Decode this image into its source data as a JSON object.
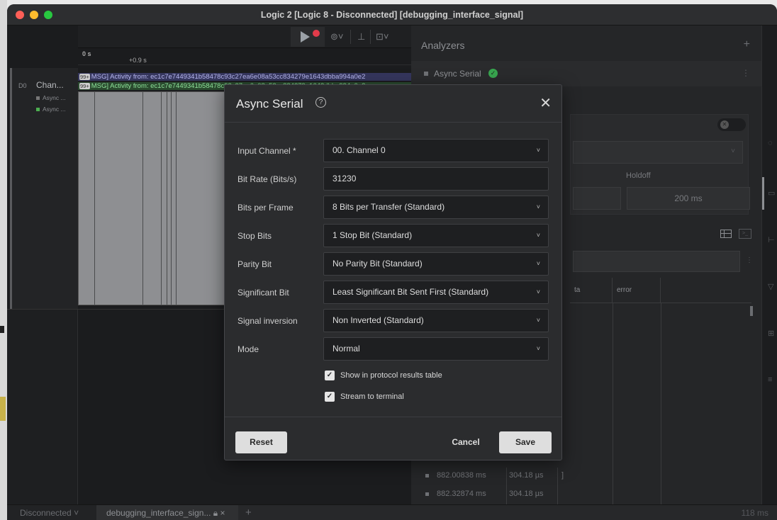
{
  "window": {
    "title": "Logic 2 [Logic 8 - Disconnected] [debugging_interface_signal]"
  },
  "ruler": {
    "t0": "0 s",
    "t1": "+0.9 s"
  },
  "channel": {
    "id": "D0",
    "name": "Chan...",
    "subs": [
      {
        "label": "Async ...",
        "color": "#777777"
      },
      {
        "label": "Async ...",
        "color": "#4caf50"
      }
    ]
  },
  "messages": {
    "badge": "99+",
    "msg1": "MSG] Activity from: ec1c7e7449341b58478c93c27ea6e08a53cc834279e1643dbba994a0e2",
    "msg2": "MSG] Activity from: ec1c7e7449341b58478c93c27ea6e08a53cc834279e1643dbba994a0e2"
  },
  "analyzers": {
    "title": "Analyzers",
    "add": "+",
    "items": [
      {
        "name": "Async Serial",
        "status": "ok"
      }
    ],
    "holdoff_label": "Holdoff",
    "holdoff_value": "200 ms",
    "columns": [
      "ta",
      "error"
    ],
    "results": [
      {
        "time": "882.00838 ms",
        "duration": "304.18 µs",
        "mark": "]"
      },
      {
        "time": "882.32874 ms",
        "duration": "304.18 µs",
        "mark": ""
      }
    ]
  },
  "dialog": {
    "title": "Async Serial",
    "help": "?",
    "close": "✕",
    "fields": [
      {
        "label": "Input Channel *",
        "value": "00.  Channel 0",
        "type": "select"
      },
      {
        "label": "Bit Rate (Bits/s)",
        "value": "31230",
        "type": "input"
      },
      {
        "label": "Bits per Frame",
        "value": "8 Bits per Transfer (Standard)",
        "type": "select"
      },
      {
        "label": "Stop Bits",
        "value": "1 Stop Bit (Standard)",
        "type": "select"
      },
      {
        "label": "Parity Bit",
        "value": "No Parity Bit (Standard)",
        "type": "select"
      },
      {
        "label": "Significant Bit",
        "value": "Least Significant Bit Sent First (Standard)",
        "type": "select"
      },
      {
        "label": "Signal inversion",
        "value": "Non Inverted (Standard)",
        "type": "select"
      },
      {
        "label": "Mode",
        "value": "Normal",
        "type": "select"
      }
    ],
    "checkboxes": [
      {
        "label": "Show in protocol results table",
        "checked": true
      },
      {
        "label": "Stream to terminal",
        "checked": true
      }
    ],
    "reset": "Reset",
    "cancel": "Cancel",
    "save": "Save"
  },
  "statusbar": {
    "connection": "Disconnected",
    "tab": "debugging_interface_sign...",
    "add": "+",
    "timing": "118 ms"
  }
}
